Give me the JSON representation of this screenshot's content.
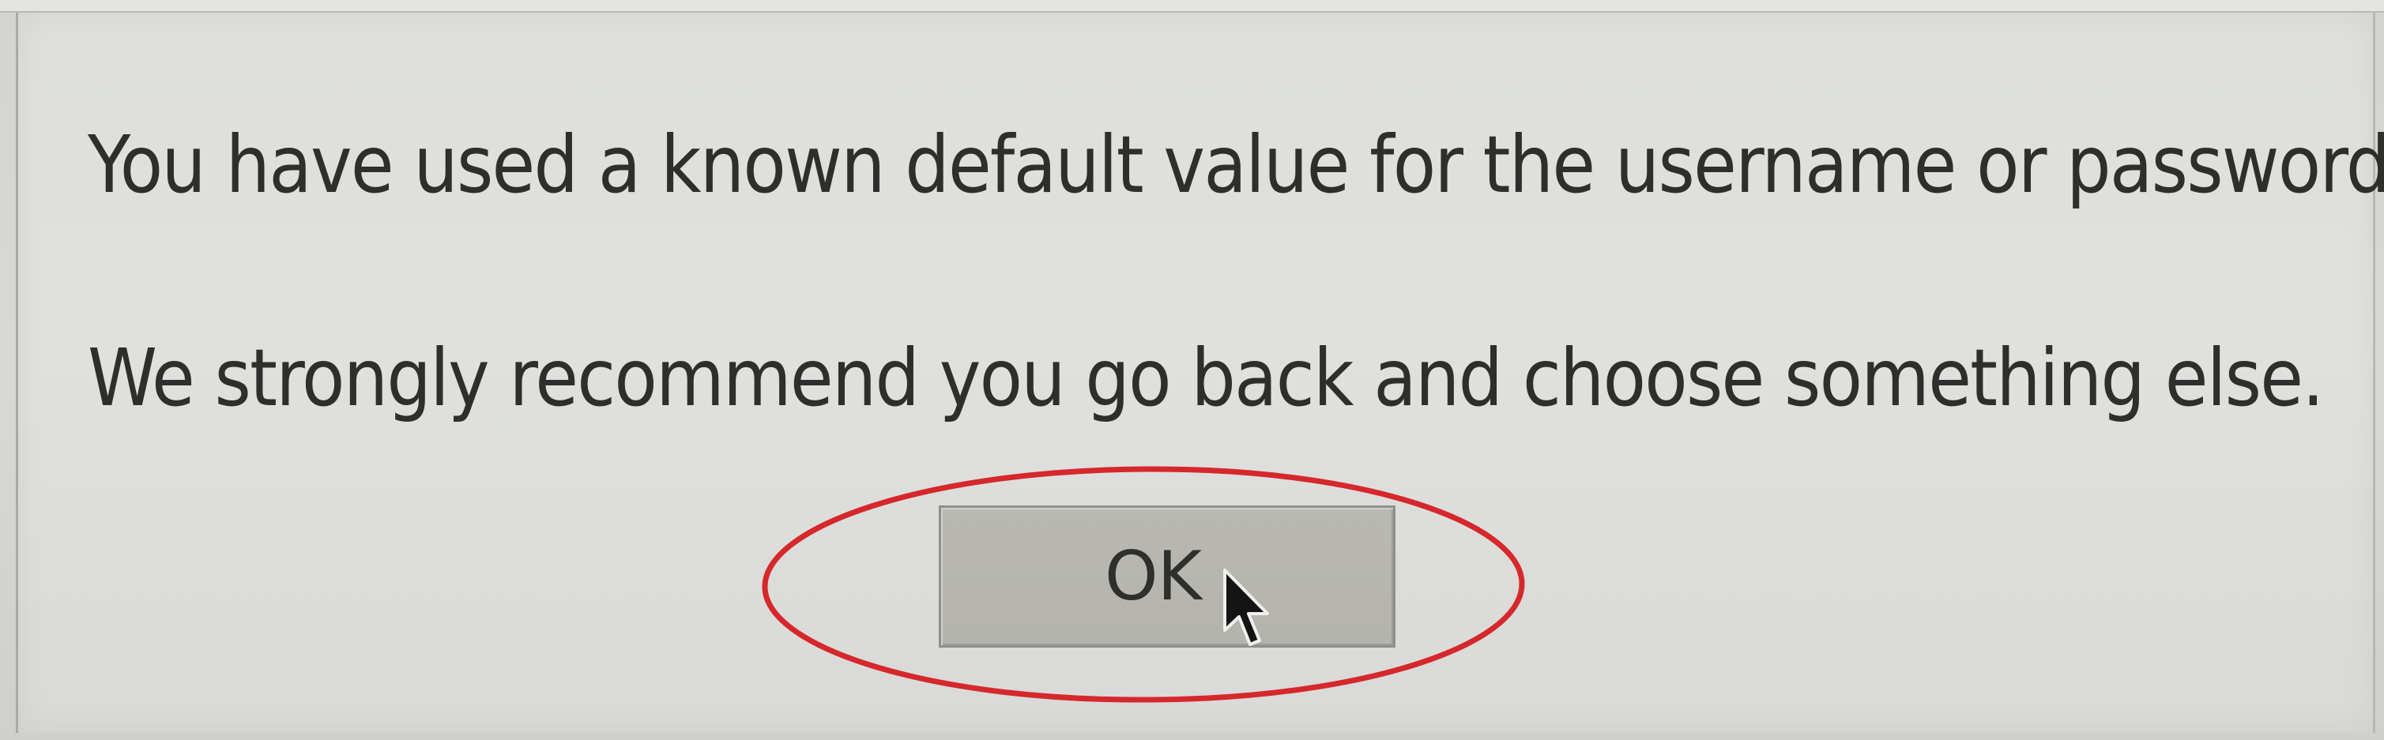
{
  "dialog": {
    "message_line_1": "You have used a known default value for the username or password.",
    "message_line_2": "We strongly recommend you go back and choose something else.",
    "ok_label": "OK"
  },
  "colors": {
    "dialog_background": "#dedfdc",
    "text": "#2e2f2d",
    "button_background": "#b6b5af",
    "annotation_outline": "#d6282c"
  },
  "icons": {
    "pointer": "mouse-pointer-icon",
    "highlight": "red-ellipse-annotation"
  }
}
